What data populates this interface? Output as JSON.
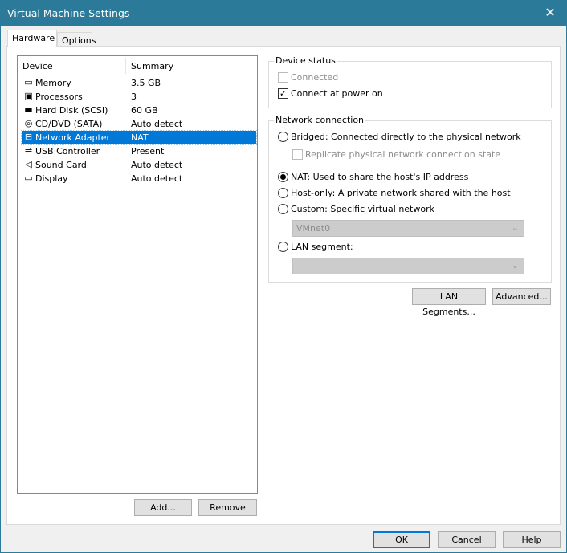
{
  "window": {
    "title": "Virtual Machine Settings",
    "close": "✕"
  },
  "tabs": [
    {
      "label": "Hardware"
    },
    {
      "label": "Options"
    }
  ],
  "device_list": {
    "headers": {
      "device": "Device",
      "summary": "Summary"
    },
    "items": [
      {
        "name": "Memory",
        "summary": "3.5 GB",
        "icon": "▭"
      },
      {
        "name": "Processors",
        "summary": "3",
        "icon": "▣"
      },
      {
        "name": "Hard Disk (SCSI)",
        "summary": "60 GB",
        "icon": "▬"
      },
      {
        "name": "CD/DVD (SATA)",
        "summary": "Auto detect",
        "icon": "◎"
      },
      {
        "name": "Network Adapter",
        "summary": "NAT",
        "icon": "⊟"
      },
      {
        "name": "USB Controller",
        "summary": "Present",
        "icon": "⇌"
      },
      {
        "name": "Sound Card",
        "summary": "Auto detect",
        "icon": "◁"
      },
      {
        "name": "Display",
        "summary": "Auto detect",
        "icon": "▭"
      }
    ]
  },
  "list_buttons": {
    "add": "Add...",
    "remove": "Remove"
  },
  "device_status": {
    "legend": "Device status",
    "connected": "Connected",
    "connect_power_on": "Connect at power on"
  },
  "network": {
    "legend": "Network connection",
    "bridged": "Bridged: Connected directly to the physical network",
    "replicate": "Replicate physical network connection state",
    "nat": "NAT: Used to share the host's IP address",
    "hostonly": "Host-only: A private network shared with the host",
    "custom": "Custom: Specific virtual network",
    "custom_value": "VMnet0",
    "lan": "LAN segment:",
    "lan_value": ""
  },
  "net_buttons": {
    "lan_segments": "LAN Segments...",
    "advanced": "Advanced..."
  },
  "footer": {
    "ok": "OK",
    "cancel": "Cancel",
    "help": "Help"
  }
}
